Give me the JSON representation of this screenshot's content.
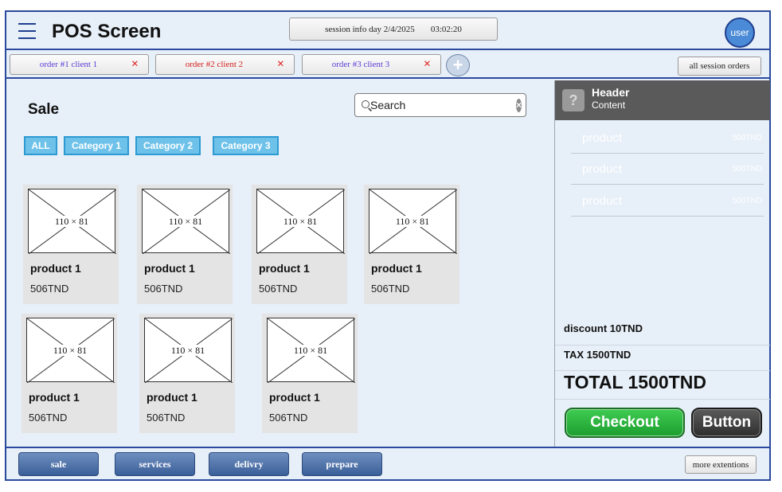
{
  "header": {
    "title": "POS Screen",
    "session_label": "session info day 2/4/2025",
    "session_time": "03:02:20",
    "user_label": "user"
  },
  "tabs": {
    "orders": [
      {
        "label": "order #1 client 1",
        "color": "#5b3ad6"
      },
      {
        "label": "order #2 client 2",
        "color": "#d62020"
      },
      {
        "label": "order #3 client 3",
        "color": "#5b3ad6"
      }
    ],
    "close_symbol": "×",
    "add_symbol": "+",
    "all_orders_label": "all session orders"
  },
  "sale": {
    "title": "Sale",
    "search_placeholder": "Search",
    "categories": [
      "ALL",
      "Category 1",
      "Category 2",
      "Category 3"
    ],
    "products": [
      {
        "image_label": "110 × 81",
        "name": "product 1",
        "price": "506TND"
      },
      {
        "image_label": "110 × 81",
        "name": "product 1",
        "price": "506TND"
      },
      {
        "image_label": "110 × 81",
        "name": "product 1",
        "price": "506TND"
      },
      {
        "image_label": "110 × 81",
        "name": "product 1",
        "price": "506TND"
      },
      {
        "image_label": "110 × 81",
        "name": "product 1",
        "price": "506TND"
      },
      {
        "image_label": "110 × 81",
        "name": "product 1",
        "price": "506TND"
      },
      {
        "image_label": "110 × 81",
        "name": "product 1",
        "price": "506TND"
      }
    ]
  },
  "cart": {
    "header_title": "Header",
    "header_content": "Content",
    "help_symbol": "?",
    "items": [
      {
        "name": "product",
        "price": "500TND"
      },
      {
        "name": "product",
        "price": "500TND"
      },
      {
        "name": "product",
        "price": "500TND"
      }
    ],
    "discount": "discount 10TND",
    "tax": "TAX 1500TND",
    "total": "TOTAL 1500TND",
    "checkout_label": "Checkout",
    "button_label": "Button"
  },
  "footer": {
    "nav": [
      "sale",
      "services",
      "delivry",
      "prepare"
    ],
    "more_label": "more extentions"
  },
  "colors": {
    "accent": "#2b4a9e",
    "category": "#6ec2ea",
    "checkout": "#1d9e2f"
  }
}
